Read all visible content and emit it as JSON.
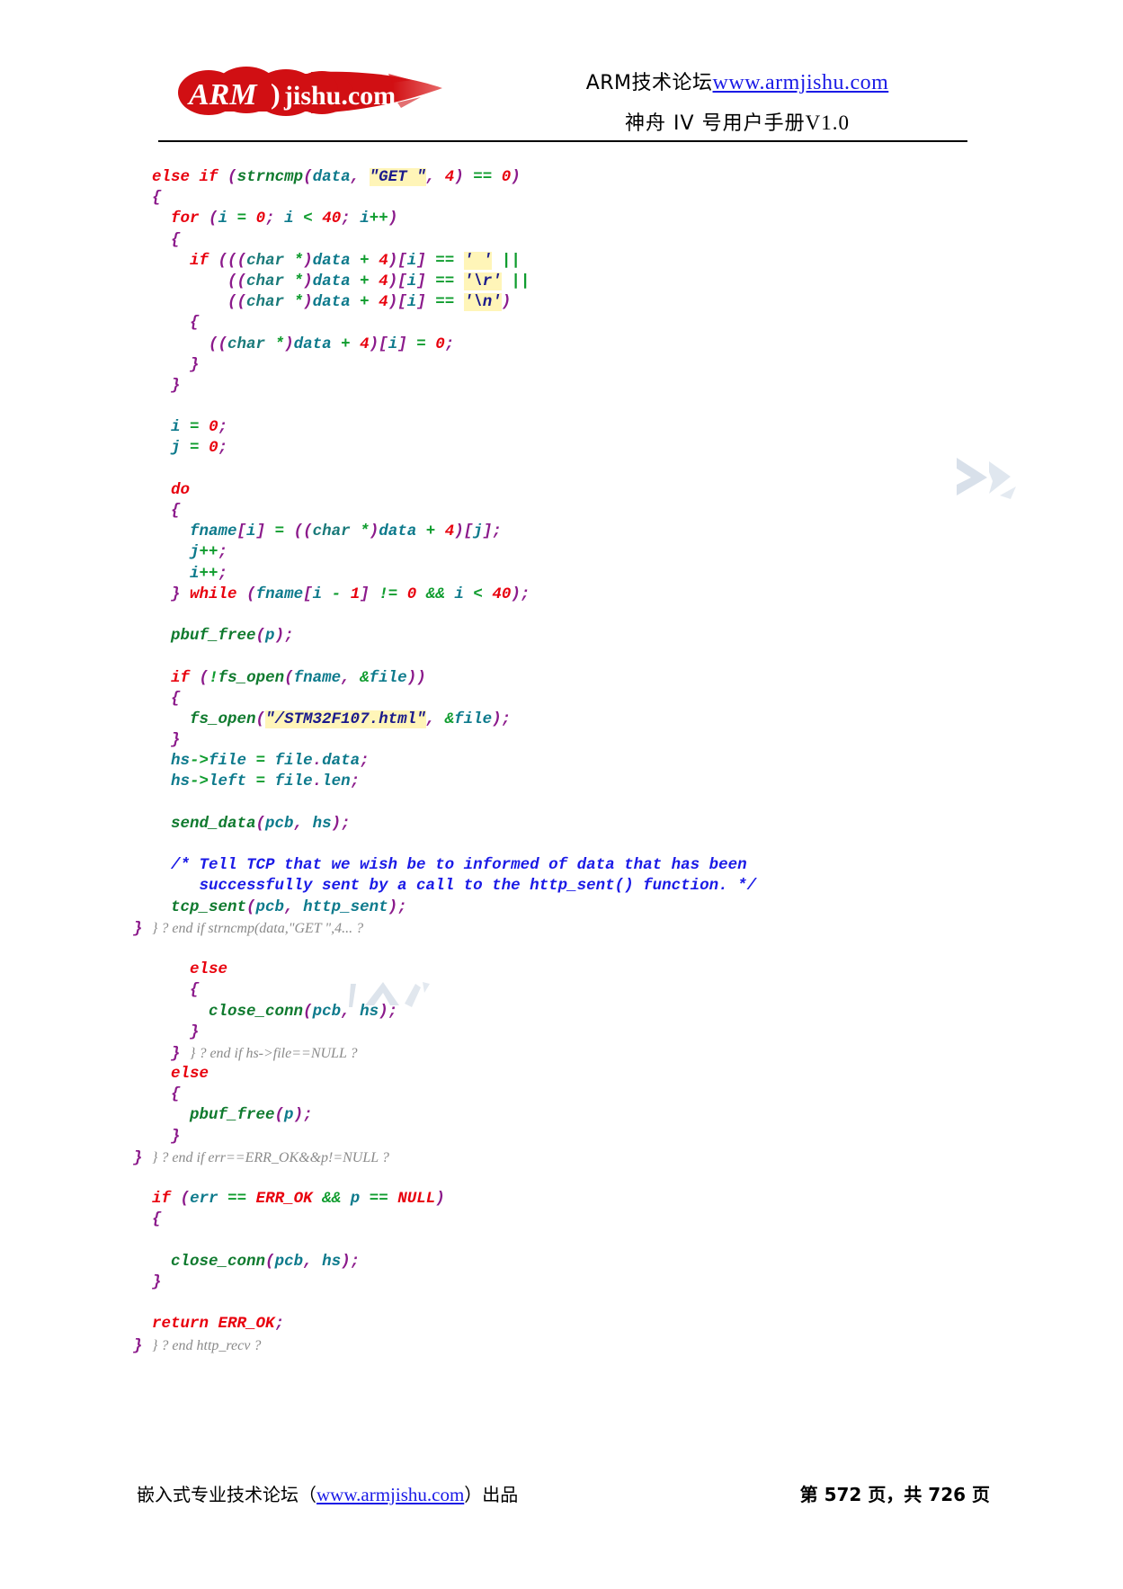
{
  "header": {
    "logo_alt": "ARMjishu.com",
    "logo_text_arm": "ARM",
    "logo_text_domain": "jishu.com",
    "line1_prefix": "ARM技术论坛",
    "line1_url": "www.armjishu.com",
    "line2": "神舟 IV 号用户手册",
    "line2_version": "V1.0"
  },
  "code": {
    "language": "C",
    "colors": {
      "keyword": "#e8000d",
      "variable": "#0d7a8c",
      "function": "#0f7a2e",
      "number": "#e8000d",
      "operator": "#0f9c2e",
      "punctuation": "#8b1a8b",
      "string": "#1a1a8c",
      "comment": "#1a1ae6",
      "highlight_bg": "#fff5b8",
      "annotation": "#8a8a8a"
    },
    "lines": [
      "else if (strncmp(data, \"GET \", 4) == 0)",
      "{",
      "  for (i = 0; i < 40; i++)",
      "  {",
      "    if (((char *)data + 4)[i] == ' ' ||",
      "        ((char *)data + 4)[i] == '\\r' ||",
      "        ((char *)data + 4)[i] == '\\n')",
      "    {",
      "      ((char *)data + 4)[i] = 0;",
      "    }",
      "  }",
      "",
      "  i = 0;",
      "  j = 0;",
      "",
      "  do",
      "  {",
      "    fname[i] = ((char *)data + 4)[j];",
      "    j++;",
      "    i++;",
      "  } while (fname[i - 1] != 0 && i < 40);",
      "",
      "  pbuf_free(p);",
      "",
      "  if (!fs_open(fname, &file))",
      "  {",
      "    fs_open(\"/STM32F107.html\", &file);",
      "  }",
      "  hs->file = file.data;",
      "  hs->left = file.len;",
      "",
      "  send_data(pcb, hs);",
      "",
      "  /* Tell TCP that we wish be to informed of data that has been",
      "     successfully sent by a call to the http_sent() function. */",
      "  tcp_sent(pcb, http_sent);",
      "} ? end if strncmp(data,\"GET \",4... ?",
      "",
      "    else",
      "    {",
      "      close_conn(pcb, hs);",
      "    }",
      "  } ? end if hs->file==NULL ?",
      "  else",
      "  {",
      "    pbuf_free(p);",
      "  }",
      "} ? end if err==ERR_OK&&p!=NULL ?",
      "",
      "if (err == ERR_OK && p == NULL)",
      "{",
      "",
      "  close_conn(pcb, hs);",
      "}",
      "",
      "return ERR_OK;",
      "} ? end http_recv ?"
    ],
    "highlighted_strings": [
      "\"GET \"",
      "' '",
      "'\\r'",
      "'\\n'",
      "\"/STM32F107.html\""
    ],
    "annotations": [
      "} ? end if strncmp(data,\"GET \",4... ?",
      "} ? end if hs->file==NULL ?",
      "} ? end if err==ERR_OK&&p!=NULL ?",
      "} ? end http_recv ?"
    ]
  },
  "footer": {
    "left_prefix": "嵌入式专业技术论坛",
    "left_open": "（",
    "left_url": "www.armjishu.com",
    "left_close": "）",
    "left_suffix": "出品",
    "page_prefix": "第",
    "page_number": "572",
    "page_mid": "页，共",
    "page_total": "726",
    "page_suffix": "页"
  }
}
